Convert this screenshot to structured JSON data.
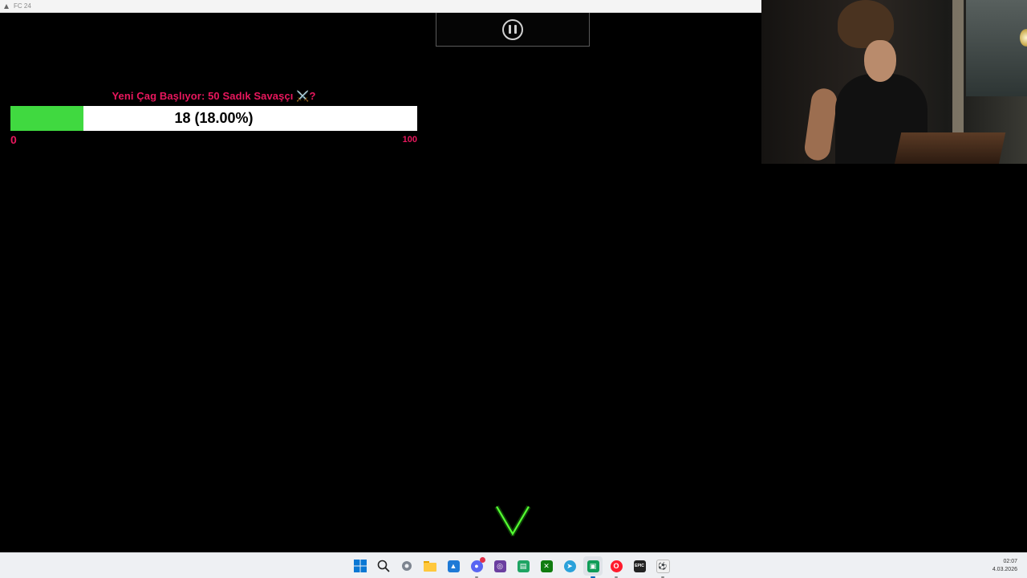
{
  "window": {
    "title": "FC 24"
  },
  "goal": {
    "title": "Yeni Çag Başlıyor: 50 Sadık Savaşçı ⚔️?",
    "progress_text": "18 (18.00%)",
    "current": 18,
    "percent": 18,
    "min_label": "0",
    "max_label": "100",
    "colors": {
      "title": "#e8175d",
      "fill": "#40d940",
      "track": "#ffffff"
    }
  },
  "taskbar": {
    "icons": [
      "windows-start-icon",
      "search-icon",
      "settings-icon",
      "file-explorer-icon",
      "photos-icon",
      "discord-icon",
      "obs-icon",
      "sheets-icon",
      "xbox-icon",
      "telegram-icon",
      "chat-app-icon",
      "opera-icon",
      "epic-games-icon",
      "ea-app-icon"
    ],
    "clock": {
      "time": "02:07",
      "date": "4.03.2026"
    }
  }
}
